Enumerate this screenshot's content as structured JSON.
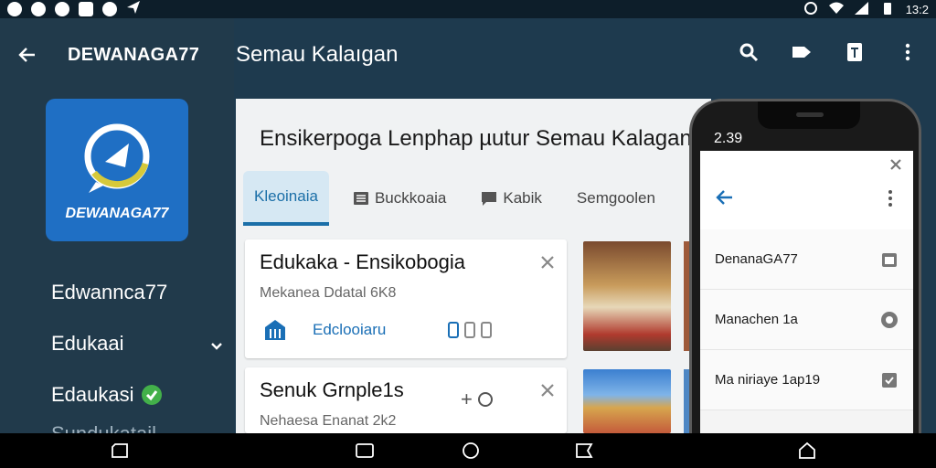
{
  "status_bar": {
    "time": "13:2"
  },
  "drawer": {
    "title": "DEWANAGA77",
    "logo_text": "DEWANAGA77",
    "items": [
      {
        "label": "Edwannca77"
      },
      {
        "label": "Edukaai",
        "icon": "chevron-down-icon"
      },
      {
        "label": "Edaukasi",
        "icon": "check-badge-icon"
      },
      {
        "label": "Sundukatail..."
      }
    ]
  },
  "app_bar": {
    "title": "Semau Kalaıgan",
    "actions": [
      "search-icon",
      "label-icon",
      "notebook-icon",
      "more-vert-icon"
    ]
  },
  "content": {
    "heading": "Ensikerpoga Lenphap µutur Semau Kalagan",
    "tabs": [
      {
        "label": "Kleoinaia",
        "active": true
      },
      {
        "label": "Buckkoaia",
        "icon": "list-icon"
      },
      {
        "label": "Kabik",
        "icon": "chat-icon"
      },
      {
        "label": "Semgoolen"
      }
    ],
    "cards": [
      {
        "title": "Edukaka - Ensikobogia",
        "subtitle": "Mekanea Ddatal 6K8",
        "link_label": "Edclooiaru"
      },
      {
        "title": "Senuk Grnple1s",
        "subtitle": "Nehaesa Enanat 2k2"
      }
    ]
  },
  "phone": {
    "time": "2.39",
    "rows": [
      {
        "label": "DenanaGA77"
      },
      {
        "label": "Manachen 1a"
      },
      {
        "label": "Ma niriaye 1ap19"
      }
    ]
  },
  "colors": {
    "background": "#1e3a4e",
    "drawer": "#213a4b",
    "accent_blue": "#1a6fb6",
    "logo_blue": "#1f6fc4",
    "logo_yellow": "#d6c93a",
    "check_green": "#43b04a"
  }
}
